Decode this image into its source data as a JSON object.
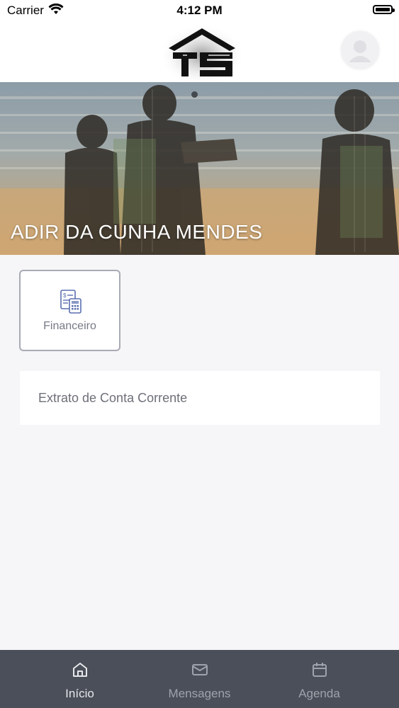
{
  "status_bar": {
    "carrier": "Carrier",
    "time": "4:12 PM"
  },
  "header": {
    "logo": "TS",
    "avatar_icon": "user-icon"
  },
  "banner": {
    "name": "ADIR DA CUNHA MENDES"
  },
  "tiles": [
    {
      "label": "Financeiro",
      "icon": "calculator-document-icon"
    }
  ],
  "list": [
    {
      "label": "Extrato de Conta Corrente"
    }
  ],
  "tabbar": {
    "items": [
      {
        "label": "Início",
        "icon": "home-icon",
        "active": true
      },
      {
        "label": "Mensagens",
        "icon": "mail-icon",
        "active": false
      },
      {
        "label": "Agenda",
        "icon": "calendar-icon",
        "active": false
      }
    ]
  },
  "colors": {
    "tabbar_bg": "#4a4f59",
    "tile_border": "#a8aab6",
    "icon_accent": "#5b6fb0"
  }
}
